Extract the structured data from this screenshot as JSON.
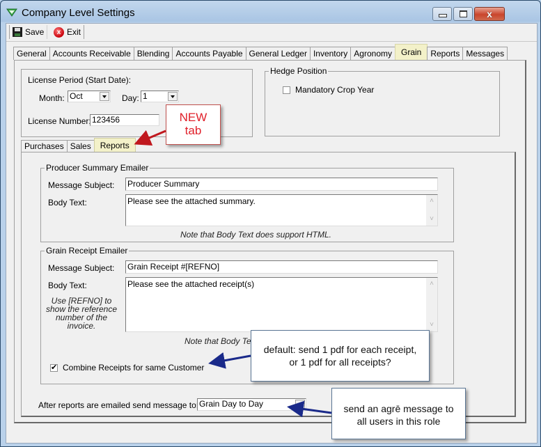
{
  "window": {
    "title": "Company Level Settings",
    "controls": {
      "minimize": "minimize",
      "maximize": "maximize",
      "close": "x"
    }
  },
  "toolbar": {
    "save_label": "Save",
    "exit_label": "Exit",
    "exit_glyph": "x"
  },
  "tabs": [
    {
      "label": "General"
    },
    {
      "label": "Accounts Receivable"
    },
    {
      "label": "Blending"
    },
    {
      "label": "Accounts Payable"
    },
    {
      "label": "General Ledger"
    },
    {
      "label": "Inventory"
    },
    {
      "label": "Agronomy"
    },
    {
      "label": "Grain",
      "active": true
    },
    {
      "label": "Reports"
    },
    {
      "label": "Messages"
    }
  ],
  "license": {
    "group_title": "License Period (Start Date):",
    "month_label": "Month:",
    "month_value": "Oct",
    "day_label": "Day:",
    "day_value": "1",
    "number_label": "License Number:",
    "number_value": "123456"
  },
  "hedge": {
    "group_title": "Hedge Position",
    "mandatory_crop_year_label": "Mandatory Crop Year",
    "mandatory_crop_year_checked": false
  },
  "inner_tabs": [
    {
      "label": "Purchases"
    },
    {
      "label": "Sales"
    },
    {
      "label": "Reports",
      "active": true
    }
  ],
  "producer_summary": {
    "group_title": "Producer Summary Emailer",
    "subject_label": "Message Subject:",
    "subject_value": "Producer Summary",
    "body_label": "Body Text:",
    "body_value": "Please see the attached summary.",
    "note": "Note that Body Text does support HTML."
  },
  "grain_receipt": {
    "group_title": "Grain Receipt Emailer",
    "subject_label": "Message Subject:",
    "subject_value": "Grain Receipt #[REFNO]",
    "body_label": "Body Text:",
    "body_value": "Please see the attached receipt(s)",
    "hint": "Use [REFNO] to show the reference number of the invoice.",
    "note": "Note that Body Text does support HTML.",
    "combine_label": "Combine Receipts for same Customer",
    "combine_checked": true
  },
  "after_reports": {
    "label": "After reports are emailed send message to:",
    "value": "Grain Day to Day"
  },
  "callouts": {
    "new_tab": {
      "line1": "NEW",
      "line2": "tab"
    },
    "combine": {
      "line1": "default: send 1 pdf for each receipt,",
      "line2": "or 1 pdf for all receipts?"
    },
    "message": {
      "line1": "send an agrē message to",
      "line2": "all users in this role"
    }
  },
  "scroll_glyphs": {
    "up": "˄",
    "down": "˅"
  },
  "colors": {
    "active_tab": "#f3f1c9",
    "callout_red": "#e0202a",
    "arrow_red": "#c0181e",
    "arrow_blue": "#1a2a8a",
    "window_frame": "#b9d1ea"
  }
}
